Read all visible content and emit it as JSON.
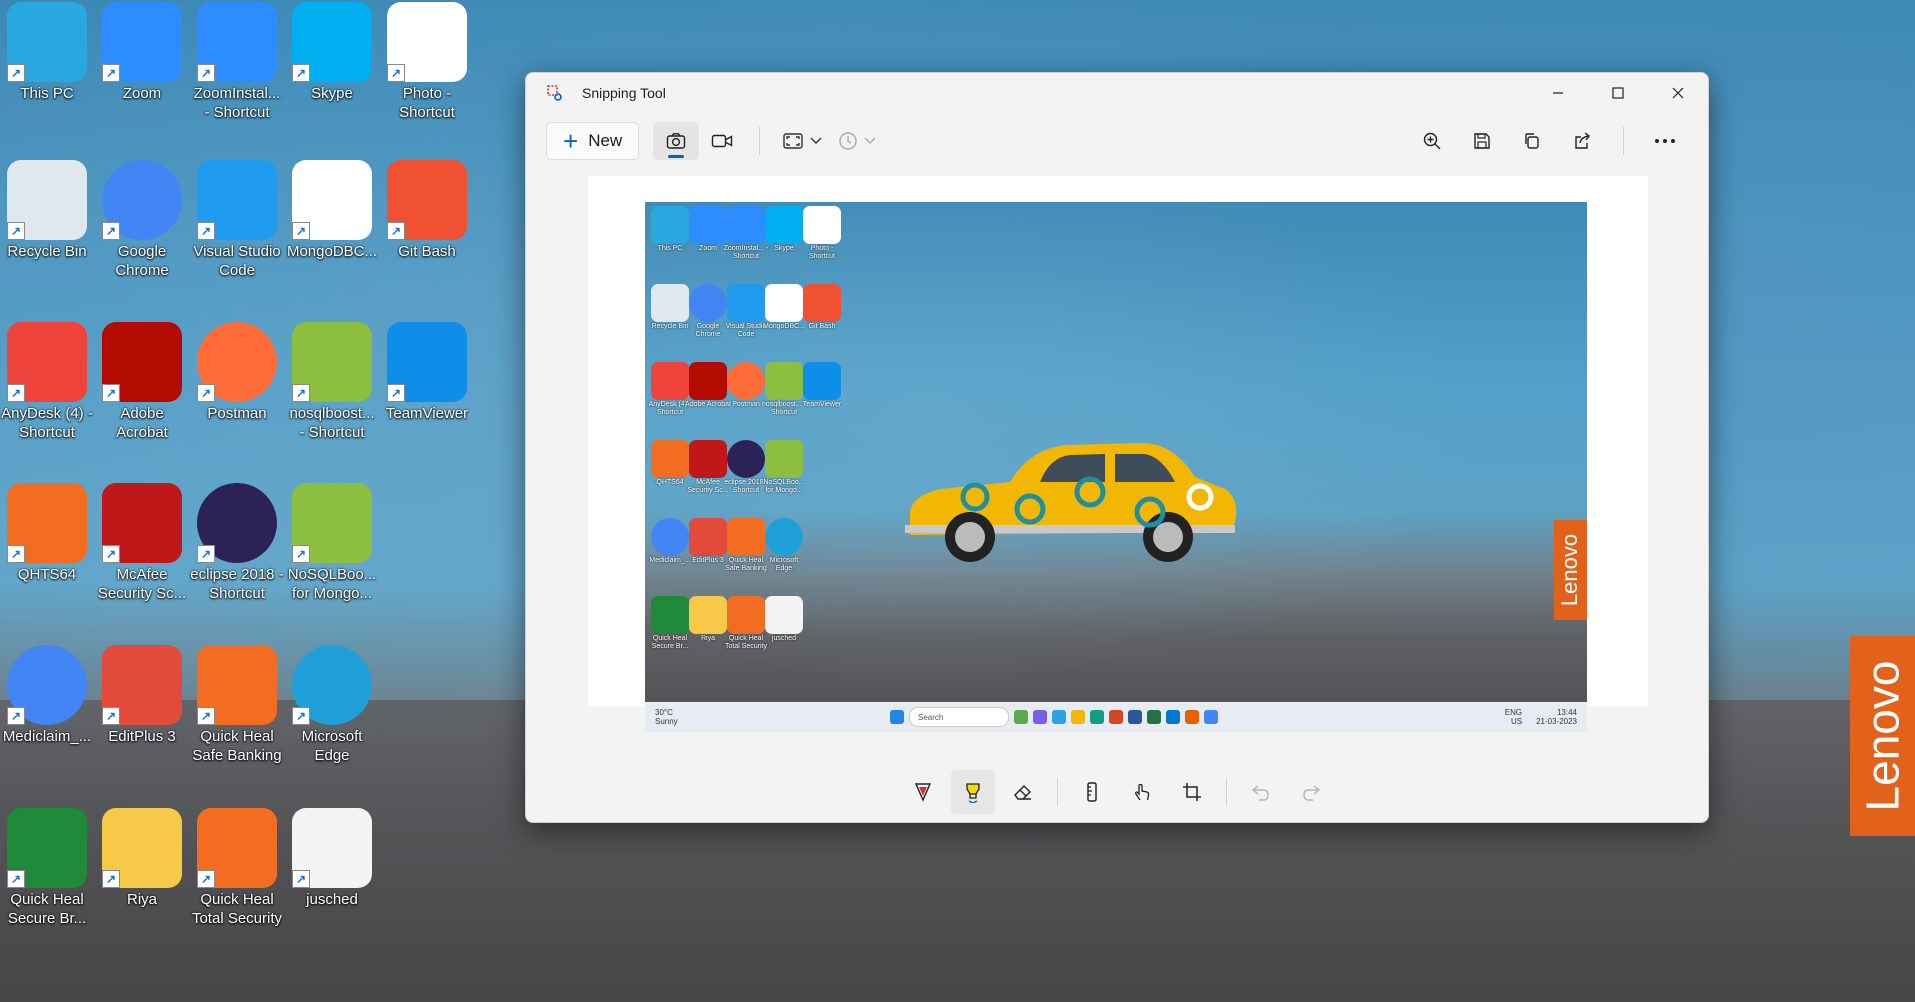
{
  "desktop": {
    "wallpaper_brand": "Lenovo",
    "icons": [
      {
        "label": "This PC",
        "icon": "monitor-icon",
        "color": "#29a8e0"
      },
      {
        "label": "Zoom",
        "icon": "zoom-icon",
        "color": "#2d8cff"
      },
      {
        "label": "ZoomInstal... - Shortcut",
        "icon": "zoom-installer-icon",
        "color": "#2d8cff"
      },
      {
        "label": "Skype",
        "icon": "skype-icon",
        "color": "#00aff0"
      },
      {
        "label": "Photo - Shortcut",
        "icon": "photo-icon",
        "color": "#ffffff"
      },
      {
        "label": "Recycle Bin",
        "icon": "recycle-bin-icon",
        "color": "#dfe8ef"
      },
      {
        "label": "Google Chrome",
        "icon": "chrome-icon",
        "color": "#4285f4"
      },
      {
        "label": "Visual Studio Code",
        "icon": "vscode-icon",
        "color": "#1f9cf0"
      },
      {
        "label": "MongoDBC...",
        "icon": "mongodb-icon",
        "color": "#ffffff"
      },
      {
        "label": "Git Bash",
        "icon": "git-bash-icon",
        "color": "#f05133"
      },
      {
        "label": "AnyDesk (4) - Shortcut",
        "icon": "anydesk-icon",
        "color": "#ef443b"
      },
      {
        "label": "Adobe Acrobat",
        "icon": "acrobat-icon",
        "color": "#b30b00"
      },
      {
        "label": "Postman",
        "icon": "postman-icon",
        "color": "#ff6c37"
      },
      {
        "label": "nosqlboost... - Shortcut",
        "icon": "nosqlbooster-icon",
        "color": "#8cbf3f"
      },
      {
        "label": "TeamViewer",
        "icon": "teamviewer-icon",
        "color": "#0e8ee9"
      },
      {
        "label": "QHTS64",
        "icon": "quickheal-ts-icon",
        "color": "#f26d21"
      },
      {
        "label": "McAfee Security Sc...",
        "icon": "mcafee-icon",
        "color": "#c01818"
      },
      {
        "label": "eclipse 2018 - Shortcut",
        "icon": "eclipse-icon",
        "color": "#2c2255"
      },
      {
        "label": "NoSQLBoo... for Mongo...",
        "icon": "nosqlbooster-mongo-icon",
        "color": "#8cbf3f"
      },
      {
        "label": "Mediclaim_...",
        "icon": "chrome-profile-icon",
        "color": "#4285f4"
      },
      {
        "label": "EditPlus 3",
        "icon": "editplus-icon",
        "color": "#e24a3b"
      },
      {
        "label": "Quick Heal Safe Banking",
        "icon": "safe-banking-icon",
        "color": "#f26d21"
      },
      {
        "label": "Microsoft Edge",
        "icon": "edge-icon",
        "color": "#1fa0d8"
      },
      {
        "label": "Quick Heal Secure Br...",
        "icon": "secure-browser-icon",
        "color": "#1e8a3a"
      },
      {
        "label": "Riya",
        "icon": "folder-icon",
        "color": "#f7c948"
      },
      {
        "label": "Quick Heal Total Security",
        "icon": "quickheal-total-icon",
        "color": "#f26d21"
      },
      {
        "label": "jusched",
        "icon": "file-icon",
        "color": "#f4f4f4"
      }
    ]
  },
  "window": {
    "title": "Snipping Tool",
    "toolbar": {
      "new_label": "New"
    }
  },
  "capture": {
    "brand": "Lenovo",
    "taskbar": {
      "weather_temp": "30°C",
      "weather_desc": "Sunny",
      "search_placeholder": "Search",
      "lang_top": "ENG",
      "lang_bottom": "US",
      "time": "13:44",
      "date": "21-03-2023"
    }
  }
}
